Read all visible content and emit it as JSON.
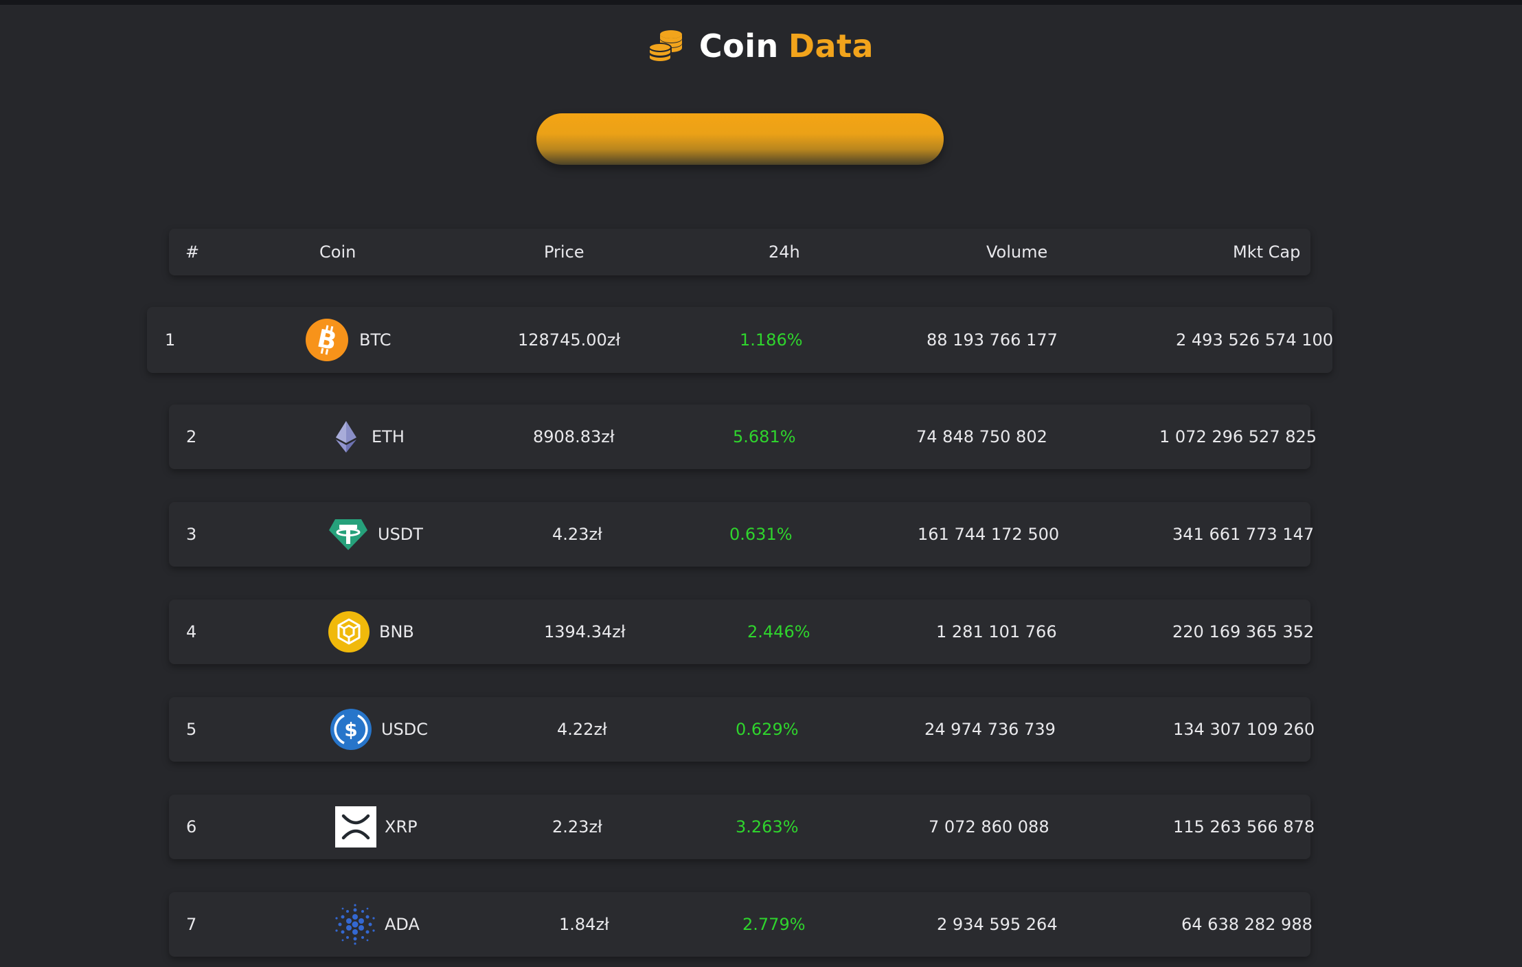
{
  "header": {
    "title_part1": "Coin",
    "title_part2": "Data",
    "logo_icon": "coins-stack-icon",
    "accent_color": "#f2a41c"
  },
  "search": {
    "value": "",
    "placeholder": ""
  },
  "table": {
    "columns": [
      "#",
      "Coin",
      "Price",
      "24h",
      "Volume",
      "Mkt Cap"
    ],
    "rows": [
      {
        "rank": "1",
        "symbol": "BTC",
        "icon": "bitcoin-icon",
        "price": "128745.00zł",
        "change": "1.186%",
        "volume": "88 193 766 177",
        "mktcap": "2 493 526 574 100"
      },
      {
        "rank": "2",
        "symbol": "ETH",
        "icon": "ethereum-icon",
        "price": "8908.83zł",
        "change": "5.681%",
        "volume": "74 848 750 802",
        "mktcap": "1 072 296 527 825"
      },
      {
        "rank": "3",
        "symbol": "USDT",
        "icon": "tether-icon",
        "price": "4.23zł",
        "change": "0.631%",
        "volume": "161 744 172 500",
        "mktcap": "341 661 773 147"
      },
      {
        "rank": "4",
        "symbol": "BNB",
        "icon": "bnb-icon",
        "price": "1394.34zł",
        "change": "2.446%",
        "volume": "1 281 101 766",
        "mktcap": "220 169 365 352"
      },
      {
        "rank": "5",
        "symbol": "USDC",
        "icon": "usdc-icon",
        "price": "4.22zł",
        "change": "0.629%",
        "volume": "24 974 736 739",
        "mktcap": "134 307 109 260"
      },
      {
        "rank": "6",
        "symbol": "XRP",
        "icon": "xrp-icon",
        "price": "2.23zł",
        "change": "3.263%",
        "volume": "7 072 860 088",
        "mktcap": "115 263 566 878"
      },
      {
        "rank": "7",
        "symbol": "ADA",
        "icon": "cardano-icon",
        "price": "1.84zł",
        "change": "2.779%",
        "volume": "2 934 595 264",
        "mktcap": "64 638 282 988"
      }
    ],
    "positive_color": "#2fd42d"
  }
}
